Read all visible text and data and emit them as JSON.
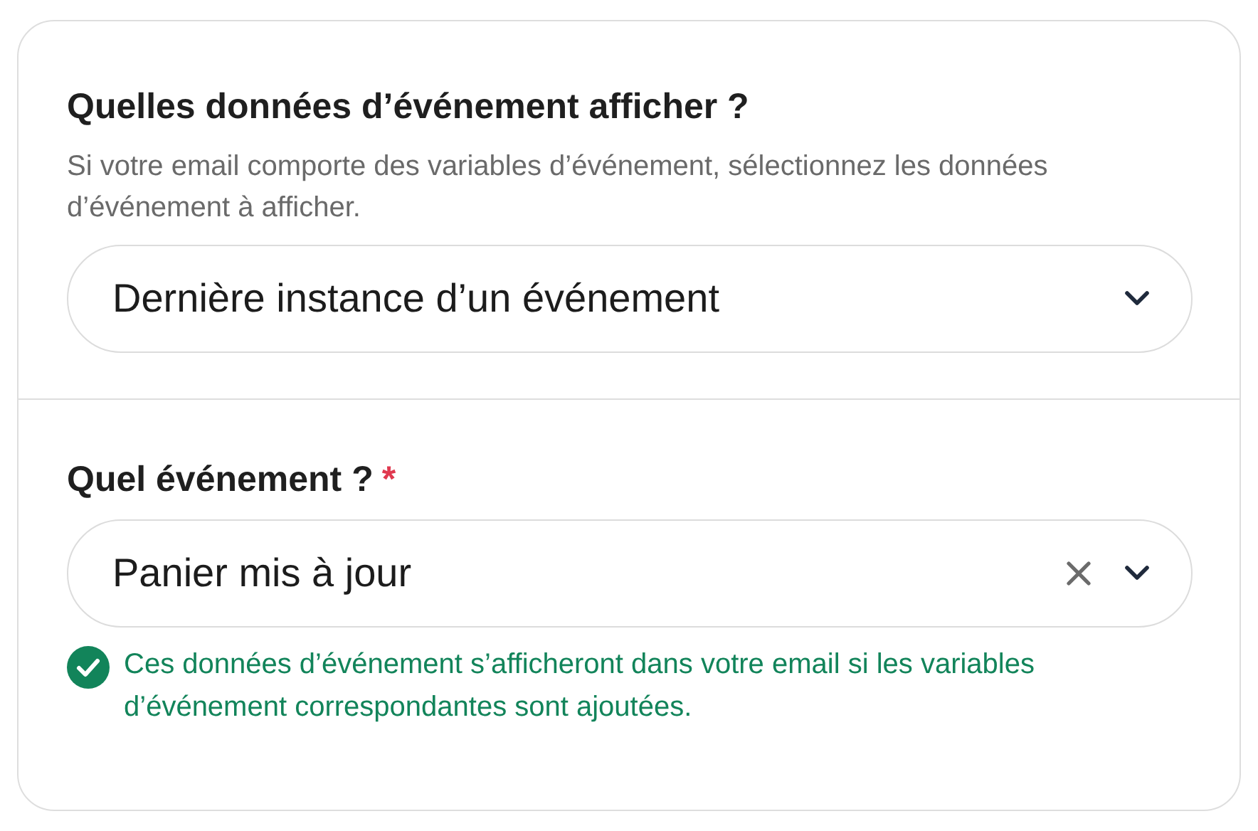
{
  "sections": [
    {
      "title": "Quelles données d’événement afficher ?",
      "description": "Si votre email comporte des variables d’événement, sélectionnez les données d’événement à afficher.",
      "select": {
        "value": "Dernière instance d’un événement"
      }
    },
    {
      "title": "Quel événement ?",
      "required_mark": "*",
      "select": {
        "value": "Panier mis à jour",
        "clearable": true
      },
      "success_message": "Ces données d’événement s’afficheront dans votre email si les variables d’événement correspondantes sont ajoutées."
    }
  ]
}
